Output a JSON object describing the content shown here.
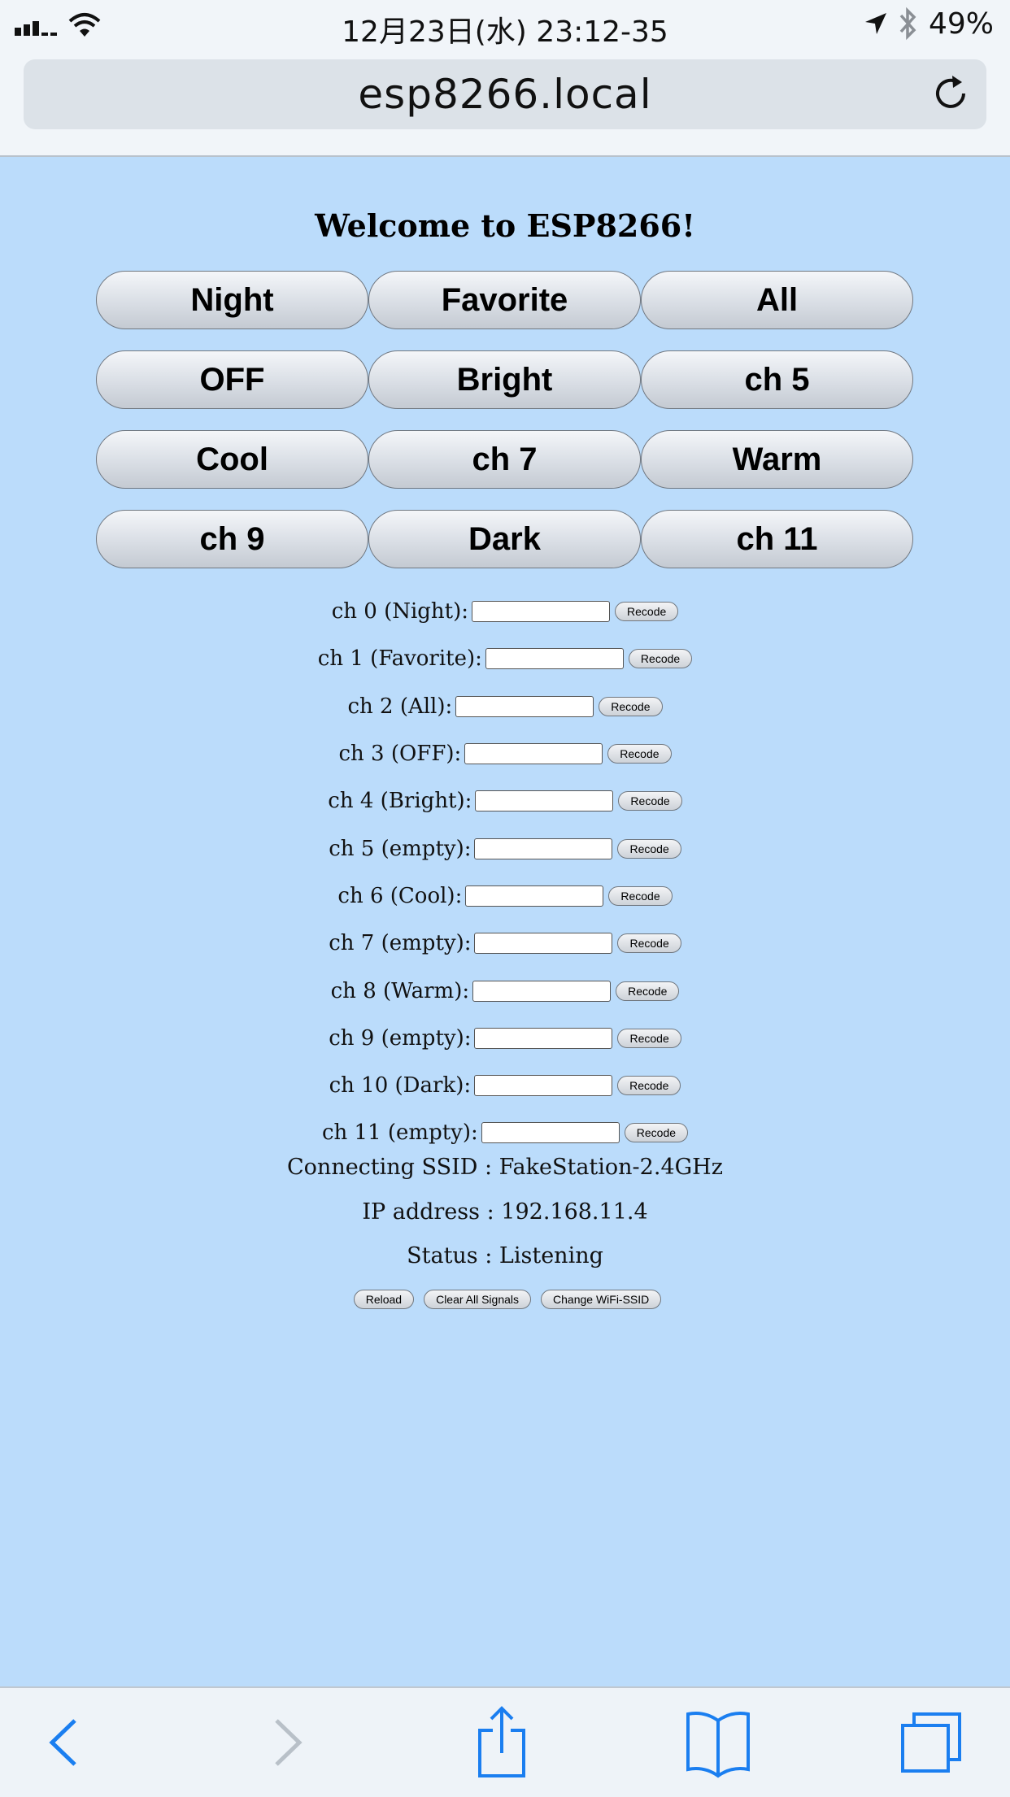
{
  "status_bar": {
    "time": "12月23日(水) 23:12-35",
    "battery": "49%",
    "icons": [
      "signal-icon",
      "wifi-icon",
      "location-arrow-icon",
      "bluetooth-icon"
    ]
  },
  "address_bar": {
    "url": "esp8266.local",
    "reload_icon": "reload-icon"
  },
  "page": {
    "title": "Welcome to ESP8266!",
    "buttons": [
      "Night",
      "Favorite",
      "All",
      "OFF",
      "Bright",
      "ch 5",
      "Cool",
      "ch 7",
      "Warm",
      "ch 9",
      "Dark",
      "ch 11"
    ],
    "channels": [
      {
        "label": "ch 0 (Night):",
        "value": "",
        "button": "Recode"
      },
      {
        "label": "ch 1 (Favorite):",
        "value": "",
        "button": "Recode"
      },
      {
        "label": "ch 2 (All):",
        "value": "",
        "button": "Recode"
      },
      {
        "label": "ch 3 (OFF):",
        "value": "",
        "button": "Recode"
      },
      {
        "label": "ch 4 (Bright):",
        "value": "",
        "button": "Recode"
      },
      {
        "label": "ch 5 (empty):",
        "value": "",
        "button": "Recode"
      },
      {
        "label": "ch 6 (Cool):",
        "value": "",
        "button": "Recode"
      },
      {
        "label": "ch 7 (empty):",
        "value": "",
        "button": "Recode"
      },
      {
        "label": "ch 8 (Warm):",
        "value": "",
        "button": "Recode"
      },
      {
        "label": "ch 9 (empty):",
        "value": "",
        "button": "Recode"
      },
      {
        "label": "ch 10 (Dark):",
        "value": "",
        "button": "Recode"
      },
      {
        "label": "ch 11 (empty):",
        "value": "",
        "button": "Recode"
      }
    ],
    "ssid_text": "Connecting SSID : FakeStation-2.4GHz",
    "ip_text": "IP address : 192.168.11.4",
    "status_text": "Status : Listening",
    "footer_buttons": [
      "Reload",
      "Clear All Signals",
      "Change WiFi-SSID"
    ]
  },
  "toolbar": {
    "icons": [
      "back-icon",
      "forward-icon",
      "share-icon",
      "bookmarks-icon",
      "tabs-icon"
    ]
  },
  "colors": {
    "page_background": "#bbdcfb",
    "chrome_background": "#f1f5f9",
    "toolbar_icon": "#1a7ef0"
  }
}
